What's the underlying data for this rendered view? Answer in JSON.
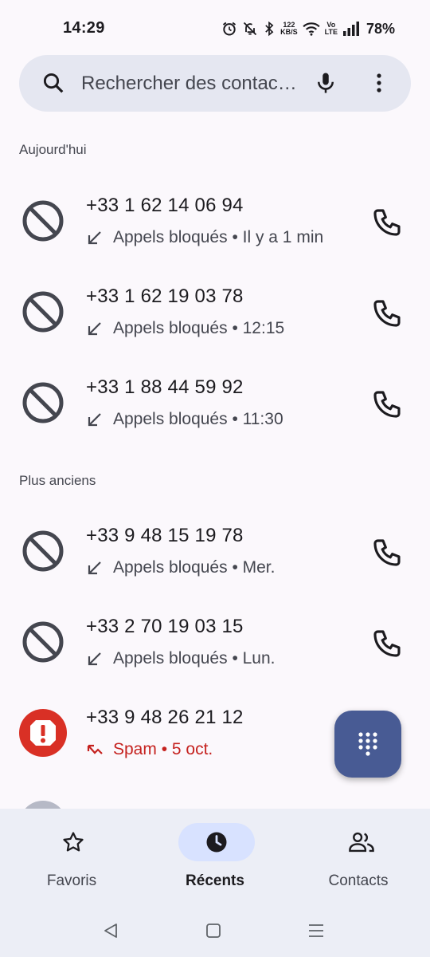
{
  "status_bar": {
    "time": "14:29",
    "net_speed_value": "122",
    "net_speed_unit": "KB/S",
    "volte_top": "Vo",
    "volte_bottom": "LTE",
    "battery": "78%"
  },
  "search": {
    "placeholder": "Rechercher des contacts et des lieux",
    "icon": "search-icon",
    "mic_icon": "mic-icon",
    "more_icon": "more-vert-icon"
  },
  "sections": [
    {
      "header": "Aujourd'hui",
      "calls": [
        {
          "number": "+33 1 62 14 06 94",
          "detail": "Appels bloqués • Il y a 1 min",
          "type": "blocked"
        },
        {
          "number": "+33 1 62 19 03 78",
          "detail": "Appels bloqués • 12:15",
          "type": "blocked"
        },
        {
          "number": "+33 1 88 44 59 92",
          "detail": "Appels bloqués • 11:30",
          "type": "blocked"
        }
      ]
    },
    {
      "header": "Plus anciens",
      "calls": [
        {
          "number": "+33 9 48 15 19 78",
          "detail": "Appels bloqués • Mer.",
          "type": "blocked"
        },
        {
          "number": "+33 2 70 19 03 15",
          "detail": "Appels bloqués • Lun.",
          "type": "blocked"
        },
        {
          "number": "+33 9 48 26 21 12",
          "detail": "Spam • 5 oct.",
          "type": "spam"
        }
      ]
    }
  ],
  "bottom_nav": {
    "items": [
      {
        "label": "Favoris",
        "icon": "star-icon",
        "active": false
      },
      {
        "label": "Récents",
        "icon": "clock-icon",
        "active": true
      },
      {
        "label": "Contacts",
        "icon": "people-icon",
        "active": false
      }
    ]
  },
  "colors": {
    "background": "#fbf8fc",
    "search_bg": "#e5e7f1",
    "fab": "#485b94",
    "spam_red": "#c5221f",
    "nav_active_pill": "#d8e2ff",
    "nav_bg": "#eceef6"
  },
  "fab": {
    "icon": "dialpad-icon"
  }
}
